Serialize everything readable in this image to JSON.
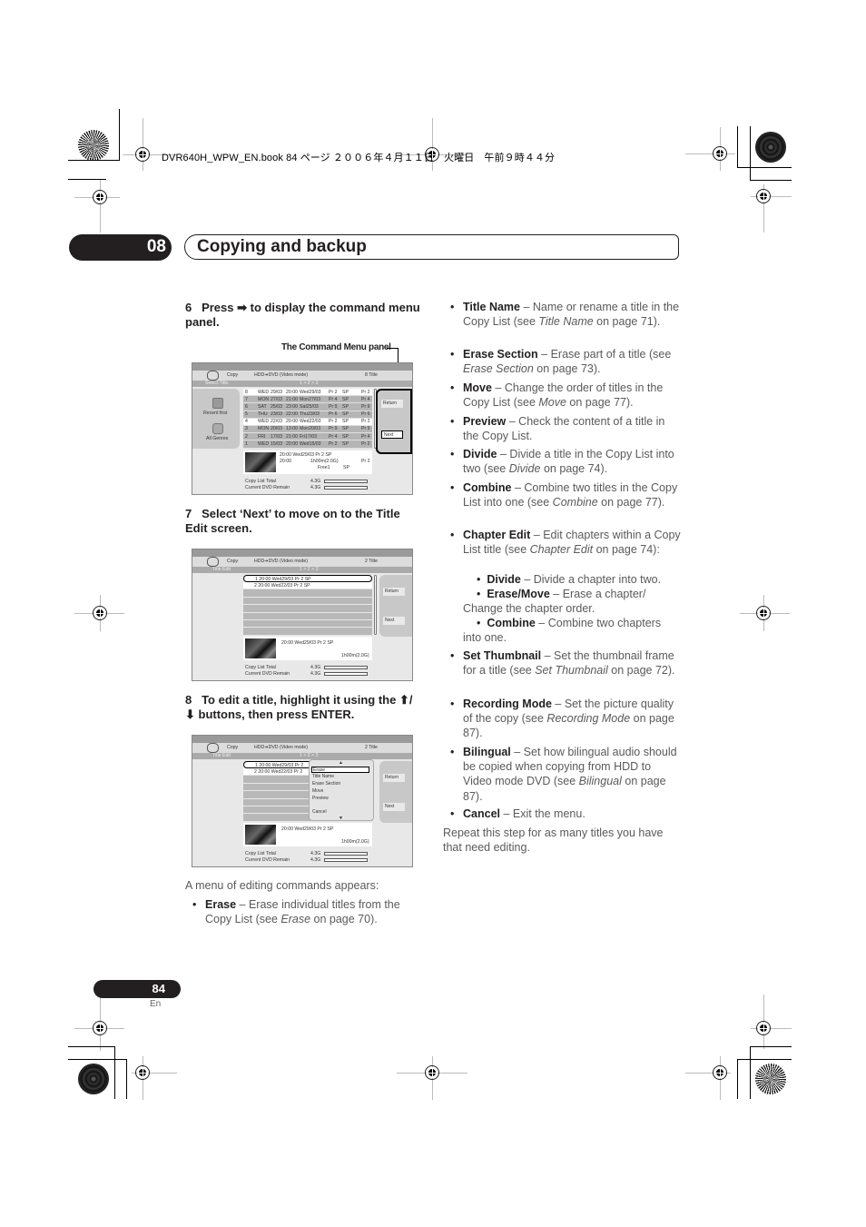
{
  "print_header": "DVR640H_WPW_EN.book  84 ページ  ２００６年４月１１日　火曜日　午前９時４４分",
  "chapter": {
    "number": "08",
    "title": "Copying and backup"
  },
  "steps": [
    {
      "number": "6",
      "text": "Press ➡ to display the command menu panel."
    },
    {
      "number": "7",
      "text": "Select ‘Next’ to move on to the Title Edit screen."
    },
    {
      "number": "8",
      "text": "To edit a title, highlight it using the ⬆/⬇ buttons, then press ENTER."
    }
  ],
  "callout": "The Command Menu panel",
  "screen1": {
    "mode": "Copy",
    "source": "HDD➔DVD (Video mode)",
    "count": "8  Title",
    "section": "Select Title",
    "pager": "1 > 2 > 3",
    "side": [
      "Recent first",
      "All Genres"
    ],
    "rows": [
      {
        "no": "8",
        "day": "WED",
        "date": "29/03",
        "time": "20:00",
        "name": "Wed29/03",
        "ch": "Pr 2",
        "mode": "SP",
        "ch2": "Pr 2",
        "selected": true
      },
      {
        "no": "7",
        "day": "MON",
        "date": "27/03",
        "time": "21:00",
        "name": "Mon27/03",
        "ch": "Pr 4",
        "mode": "SP",
        "ch2": "Pr 4"
      },
      {
        "no": "6",
        "day": "SAT",
        "date": "25/03",
        "time": "23:00",
        "name": "Sat25/03",
        "ch": "Pr 9",
        "mode": "SP",
        "ch2": "Pr 9"
      },
      {
        "no": "5",
        "day": "THU",
        "date": "23/03",
        "time": "22:00",
        "name": "Thu23/03",
        "ch": "Pr 6",
        "mode": "SP",
        "ch2": "Pr 6"
      },
      {
        "no": "4",
        "day": "WED",
        "date": "22/03",
        "time": "20:00",
        "name": "Wed22/03",
        "ch": "Pr 2",
        "mode": "SP",
        "ch2": "Pr 2",
        "selected": true
      },
      {
        "no": "3",
        "day": "MON",
        "date": "20/03",
        "time": "13:00",
        "name": "Mon20/03",
        "ch": "Pr 9",
        "mode": "SP",
        "ch2": "Pr 9"
      },
      {
        "no": "2",
        "day": "FRI",
        "date": "17/03",
        "time": "21:00",
        "name": "Fri17/03",
        "ch": "Pr 4",
        "mode": "SP",
        "ch2": "Pr 4"
      },
      {
        "no": "1",
        "day": "WED",
        "date": "15/03",
        "time": "20:00",
        "name": "Wed15/03",
        "ch": "Pr 2",
        "mode": "SP",
        "ch2": "Pr 2"
      }
    ],
    "commands": [
      "Return",
      "Next"
    ],
    "info": {
      "line1": "20:00    Wed29/03   Pr 2   SP",
      "line2a": "20:00",
      "line2b": "1h00m(2.0G)",
      "line2c": "Pr 2",
      "line3": "Free1",
      "line3b": "SP"
    },
    "totals": [
      {
        "label": "Copy List Total",
        "value": "4.3G"
      },
      {
        "label": "Current DVD Remain",
        "value": "4.3G"
      }
    ]
  },
  "screen2": {
    "mode": "Copy",
    "source": "HDD➔DVD (Video mode)",
    "count": "2  Title",
    "section": "Title Edit",
    "pager": "1 > 2 > 3",
    "rows": [
      {
        "text": "1  20:00  Wed29/03  Pr 2    SP"
      },
      {
        "text": "2  20:00  Wed22/03  Pr 2    SP"
      }
    ],
    "commands": [
      "Return",
      "Next"
    ],
    "info": {
      "line1": "20:00    Wed29/03    Pr 2    SP",
      "duration": "1h00m(2.0G)"
    },
    "totals": [
      {
        "label": "Copy List Total",
        "value": "4.3G"
      },
      {
        "label": "Current DVD Remain",
        "value": "4.3G"
      }
    ]
  },
  "screen3": {
    "mode": "Copy",
    "source": "HDD➔DVD (Video mode)",
    "count": "2  Title",
    "section": "Title Edit",
    "pager": "1 > 2 > 3",
    "rows": [
      {
        "text": "1  20:00  Wed29/03  Pr 2"
      },
      {
        "text": "2  20:00  Wed22/03  Pr 2"
      }
    ],
    "menu": [
      "Erase",
      "Title Name",
      "Erase Section",
      "Move",
      "Preview",
      "Cancel"
    ],
    "commands": [
      "Return",
      "Next"
    ],
    "info": {
      "line1": "20:00    Wed29/03    Pr 2    SP",
      "duration": "1h00m(2.0G)"
    },
    "totals": [
      {
        "label": "Copy List Total",
        "value": "4.3G"
      },
      {
        "label": "Current DVD Remain",
        "value": "4.3G"
      }
    ]
  },
  "intro": "A menu of editing commands appears:",
  "erase": {
    "term": "Erase",
    "desc": " – Erase individual titles from the Copy List (see ",
    "ref": "Erase",
    "tail": " on page 70)."
  },
  "commands": [
    {
      "term": "Title Name",
      "desc": " – Name or rename a title in the Copy List (see ",
      "ref": "Title Name",
      "tail": " on page 71)."
    },
    {
      "term": "Erase Section",
      "desc": " – Erase part of a title (see ",
      "ref": "Erase Section",
      "tail": " on page 73)."
    },
    {
      "term": "Move",
      "desc": " – Change the order of titles in the Copy List (see ",
      "ref": "Move",
      "tail": " on page 77)."
    },
    {
      "term": "Preview",
      "desc": " – Check the content of a title in the Copy List.",
      "ref": "",
      "tail": ""
    },
    {
      "term": "Divide",
      "desc": " – Divide a title in the Copy List into two (see ",
      "ref": "Divide",
      "tail": " on page 74)."
    },
    {
      "term": "Combine",
      "desc": " – Combine two titles in the Copy List into one (see ",
      "ref": "Combine",
      "tail": " on page 77)."
    },
    {
      "term": "Chapter Edit",
      "desc": " – Edit chapters within a Copy List title (see ",
      "ref": "Chapter Edit",
      "tail": " on page 74):"
    }
  ],
  "chapter_sub": [
    {
      "term": "Divide",
      "desc": " – Divide a chapter into two."
    },
    {
      "term": "Erase/Move",
      "desc": " – Erase a chapter/ Change the chapter order."
    },
    {
      "term": "Combine",
      "desc": " – Combine two chapters into one."
    }
  ],
  "commands2": [
    {
      "term": "Set Thumbnail",
      "desc": " – Set the thumbnail frame for a title (see ",
      "ref": "Set Thumbnail",
      "tail": " on page 72)."
    },
    {
      "term": "Recording Mode",
      "desc": " – Set the picture quality of the copy (see ",
      "ref": "Recording Mode",
      "tail": " on page 87)."
    },
    {
      "term": "Bilingual",
      "desc": " – Set how bilingual audio should be copied when copying from HDD to Video mode DVD (see ",
      "ref": "Bilingual",
      "tail": " on page 87)."
    },
    {
      "term": "Cancel",
      "desc": " – Exit the menu.",
      "ref": "",
      "tail": ""
    }
  ],
  "closing": "Repeat this step for as many titles you have that need editing.",
  "page": {
    "number": "84",
    "lang": "En"
  }
}
